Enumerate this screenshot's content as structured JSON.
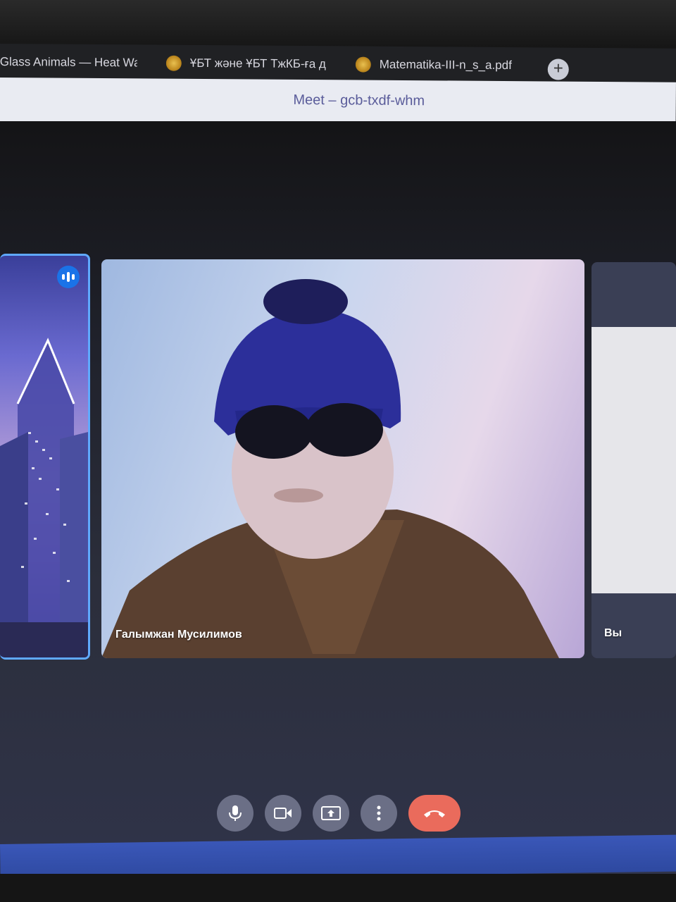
{
  "browser": {
    "tabs": [
      {
        "label": "Glass Animals — Heat Wa",
        "favicon": "music-icon"
      },
      {
        "label": "ҰБТ және ҰБТ ТжКБ-ға д",
        "favicon": "emblem-icon"
      },
      {
        "label": "Matematika-III-n_s_a.pdf",
        "favicon": "emblem-icon"
      }
    ],
    "new_tab_symbol": "+",
    "window_title": "Meet – gcb-txdf-whm"
  },
  "meet": {
    "participants": [
      {
        "name": "",
        "speaking": true
      },
      {
        "name": "Галымжан Мусилимов",
        "speaking": false
      },
      {
        "name": "Вы",
        "speaking": false
      }
    ],
    "controls": [
      {
        "name": "microphone",
        "icon": "mic-icon"
      },
      {
        "name": "camera",
        "icon": "camera-icon"
      },
      {
        "name": "present",
        "icon": "present-screen-icon"
      },
      {
        "name": "more",
        "icon": "more-vertical-icon"
      },
      {
        "name": "end-call",
        "icon": "hang-up-icon",
        "color": "#ea6b5c"
      }
    ],
    "accent_color": "#1a73e8"
  }
}
